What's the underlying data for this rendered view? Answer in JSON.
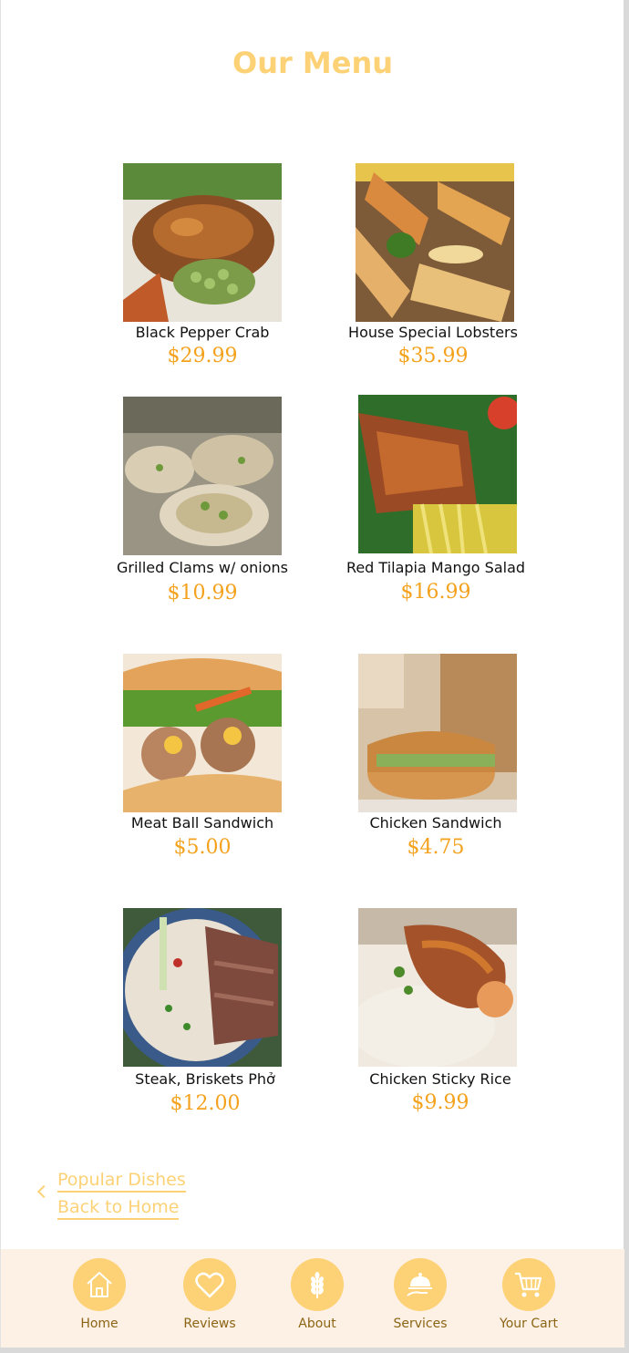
{
  "page": {
    "title": "Our Menu"
  },
  "menu": {
    "items": [
      {
        "name": "Black Pepper Crab",
        "price": "$29.99"
      },
      {
        "name": "House Special Lobsters",
        "price": "$35.99"
      },
      {
        "name": "Grilled Clams w/ onions",
        "price": "$10.99"
      },
      {
        "name": "Red Tilapia Mango Salad",
        "price": "$16.99"
      },
      {
        "name": "Meat Ball Sandwich",
        "price": "$5.00"
      },
      {
        "name": "Chicken Sandwich",
        "price": "$4.75"
      },
      {
        "name": "Steak, Briskets Phở",
        "price": "$12.00"
      },
      {
        "name": "Chicken Sticky Rice",
        "price": "$9.99"
      }
    ]
  },
  "links": {
    "popular": "Popular Dishes",
    "home": "Back to Home"
  },
  "nav": {
    "items": [
      {
        "label": "Home",
        "icon": "home-icon"
      },
      {
        "label": "Reviews",
        "icon": "heart-icon"
      },
      {
        "label": "About",
        "icon": "wheat-icon"
      },
      {
        "label": "Services",
        "icon": "cloche-icon"
      },
      {
        "label": "Your Cart",
        "icon": "cart-icon"
      }
    ]
  },
  "colors": {
    "accent": "#fdd276",
    "price": "#f4a21d",
    "nav_bg": "#fdf1e6",
    "nav_text": "#8b6514"
  }
}
